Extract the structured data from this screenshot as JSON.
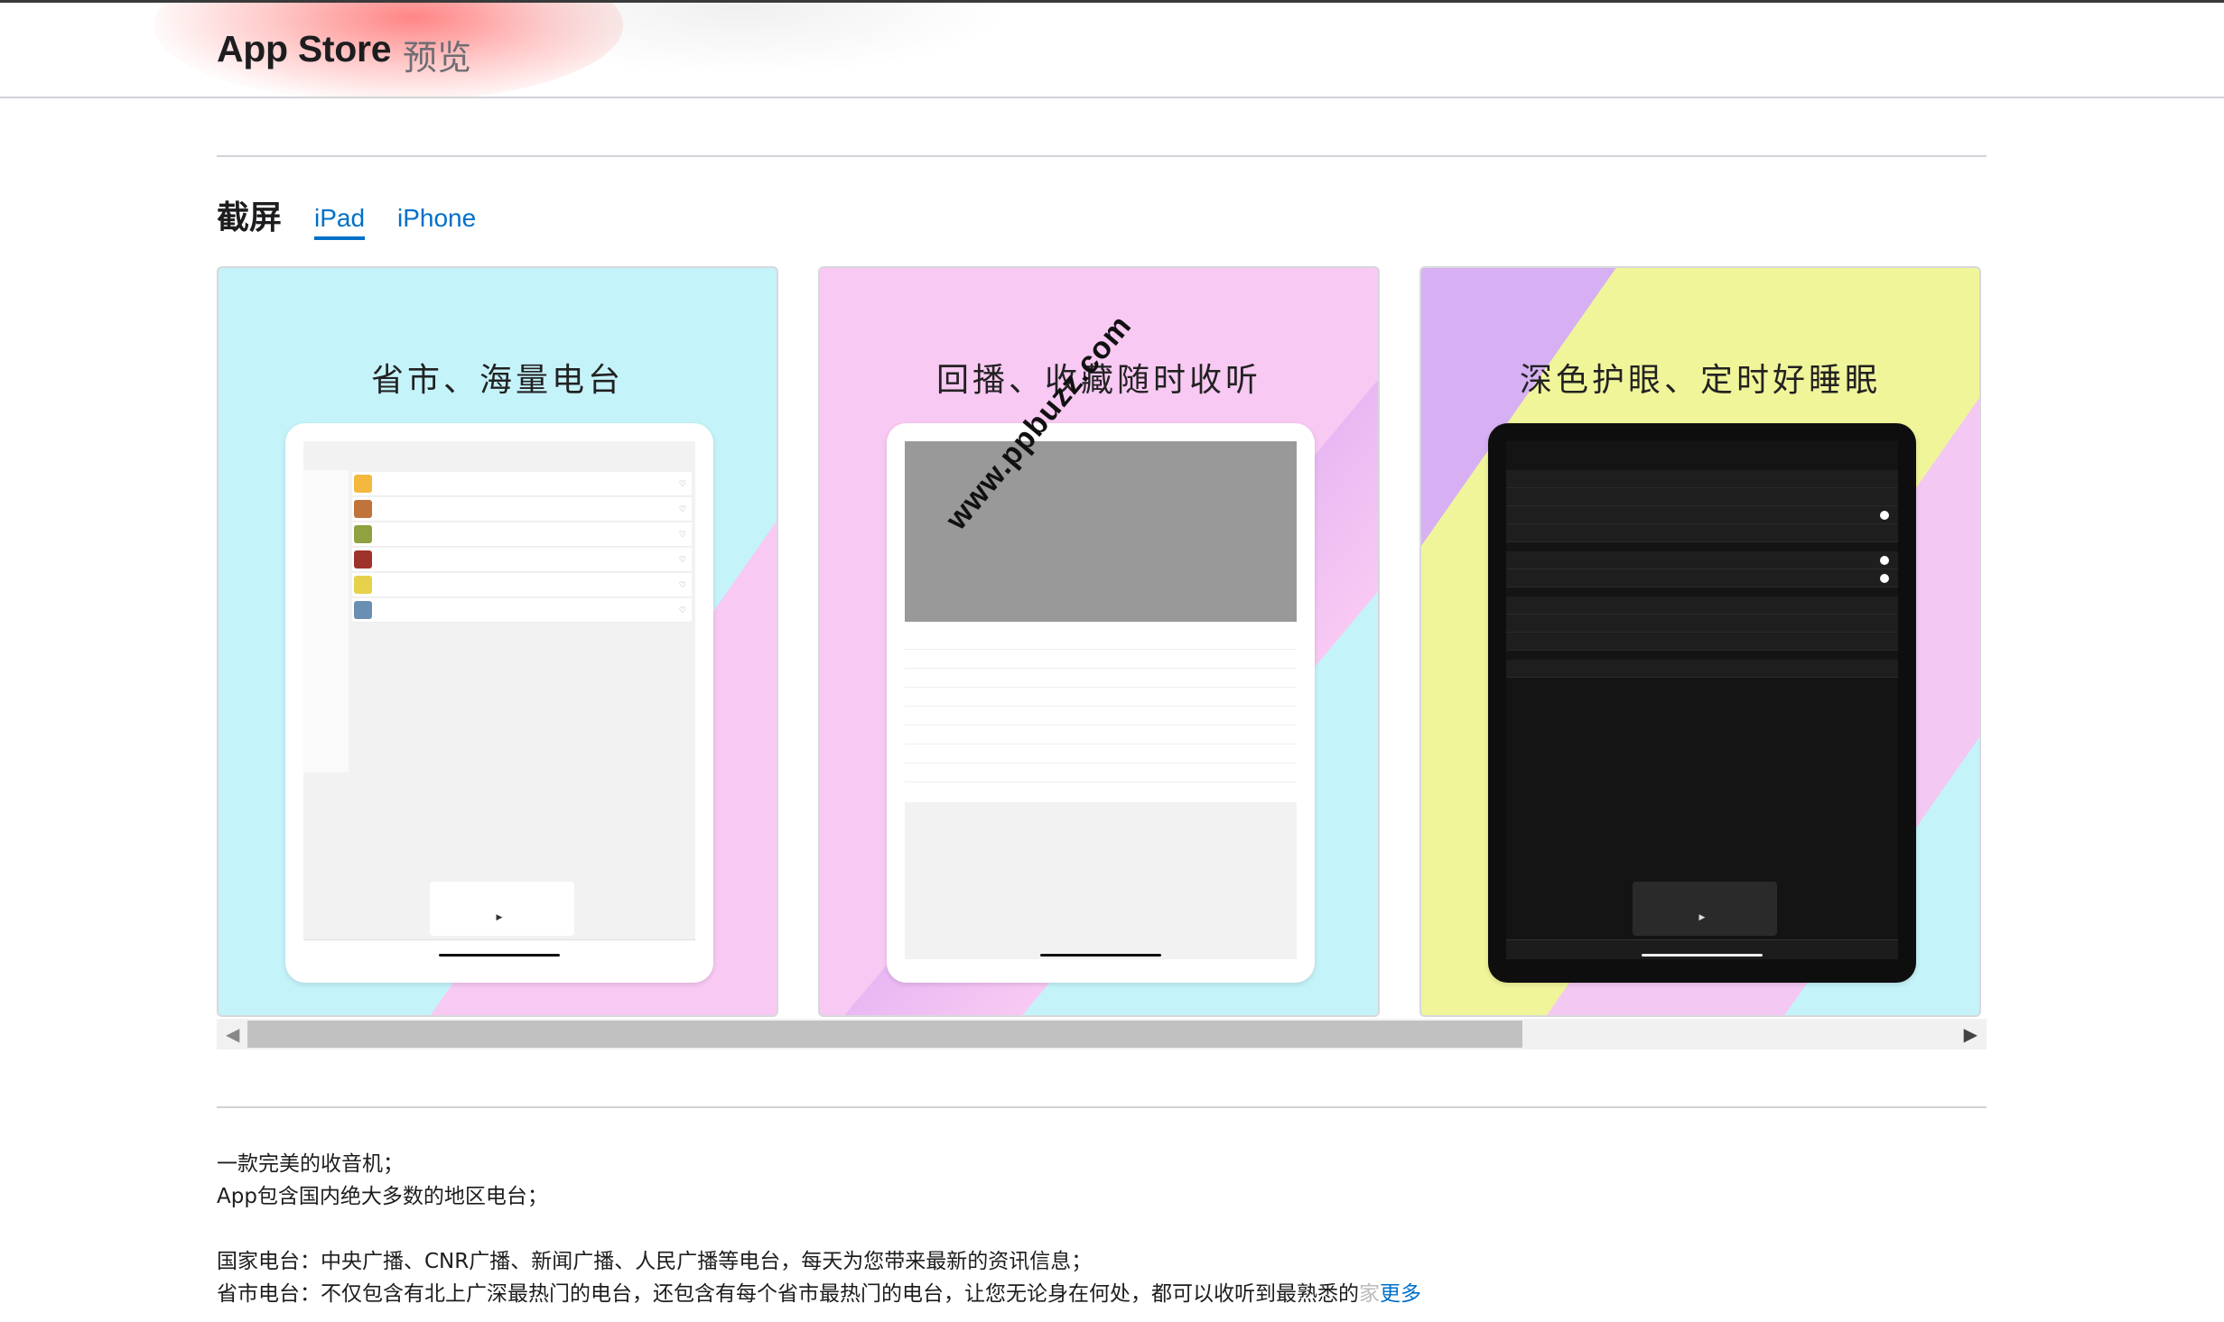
{
  "header": {
    "brand": "App Store",
    "subtitle": "预览"
  },
  "screenshots": {
    "section_title": "截屏",
    "tabs": [
      {
        "label": "iPad",
        "active": true
      },
      {
        "label": "iPhone",
        "active": false
      }
    ],
    "items": [
      {
        "caption": "省市、海量电台"
      },
      {
        "caption": "回播、收藏随时收听"
      },
      {
        "caption": "深色护眼、定时好睡眠"
      }
    ],
    "watermark": "www.ppbuzz.com"
  },
  "description": {
    "lines": [
      "一款完美的收音机；",
      "App包含国内绝大多数的地区电台；",
      "国家电台：中央广播、CNR广播、新闻广播、人民广播等电台，每天为您带来最新的资讯信息；",
      "省市电台：不仅包含有北上广深最热门的电台，还包含有每个省市最热门的电台，让您无论身在何处，都可以收听到最熟悉的"
    ],
    "truncated_tail": "家",
    "more_label": "更多"
  },
  "colors": {
    "link": "#0070c9",
    "accent_glow": "#ff7878"
  }
}
